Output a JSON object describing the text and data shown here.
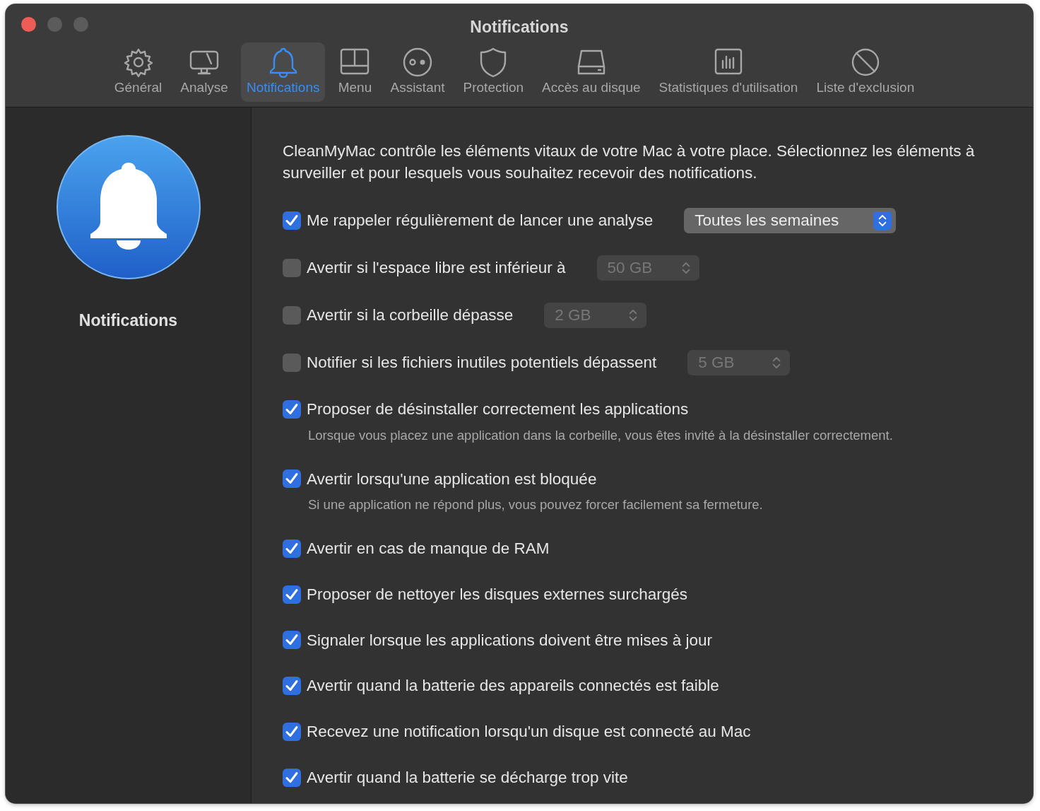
{
  "window": {
    "title": "Notifications"
  },
  "toolbar": [
    {
      "label": "Général",
      "kind": "gear",
      "selected": false
    },
    {
      "label": "Analyse",
      "kind": "monitor",
      "selected": false
    },
    {
      "label": "Notifications",
      "kind": "bell",
      "selected": true
    },
    {
      "label": "Menu",
      "kind": "layout",
      "selected": false
    },
    {
      "label": "Assistant",
      "kind": "eyes",
      "selected": false
    },
    {
      "label": "Protection",
      "kind": "shield",
      "selected": false
    },
    {
      "label": "Accès au disque",
      "kind": "disk",
      "selected": false
    },
    {
      "label": "Statistiques d'utilisation",
      "kind": "chart",
      "selected": false
    },
    {
      "label": "Liste d'exclusion",
      "kind": "ban",
      "selected": false
    }
  ],
  "sidebar": {
    "title": "Notifications"
  },
  "intro": "CleanMyMac contrôle les éléments vitaux de votre Mac à votre place. Sélectionnez les éléments à surveiller et pour lesquels vous souhaitez recevoir des notifications.",
  "options": [
    {
      "label": "Me rappeler régulièrement de lancer une analyse",
      "checked": true,
      "dropdown": {
        "value": "Toutes les semaines",
        "disabled": false
      }
    },
    {
      "label": "Avertir si l'espace libre est inférieur à",
      "checked": false,
      "dropdown": {
        "value": "50 GB",
        "disabled": true
      }
    },
    {
      "label": "Avertir si la corbeille dépasse",
      "checked": false,
      "dropdown": {
        "value": "2 GB",
        "disabled": true
      }
    },
    {
      "label": "Notifier si les fichiers inutiles potentiels dépassent",
      "checked": false,
      "dropdown": {
        "value": "5 GB",
        "disabled": true
      }
    },
    {
      "label": "Proposer de désinstaller correctement les applications",
      "checked": true,
      "description": "Lorsque vous placez une application dans la corbeille, vous êtes invité à la désinstaller correctement."
    },
    {
      "label": "Avertir lorsqu'une application est bloquée",
      "checked": true,
      "description": "Si une application ne répond plus, vous pouvez forcer facilement sa fermeture."
    },
    {
      "label": "Avertir en cas de manque de RAM",
      "checked": true
    },
    {
      "label": "Proposer de nettoyer les disques externes surchargés",
      "checked": true
    },
    {
      "label": "Signaler lorsque les applications doivent être mises à jour",
      "checked": true
    },
    {
      "label": "Avertir quand la batterie des appareils connectés est faible",
      "checked": true
    },
    {
      "label": "Recevez une notification lorsqu'un disque est connecté au Mac",
      "checked": true
    },
    {
      "label": "Avertir quand la batterie se décharge trop vite",
      "checked": true
    }
  ]
}
